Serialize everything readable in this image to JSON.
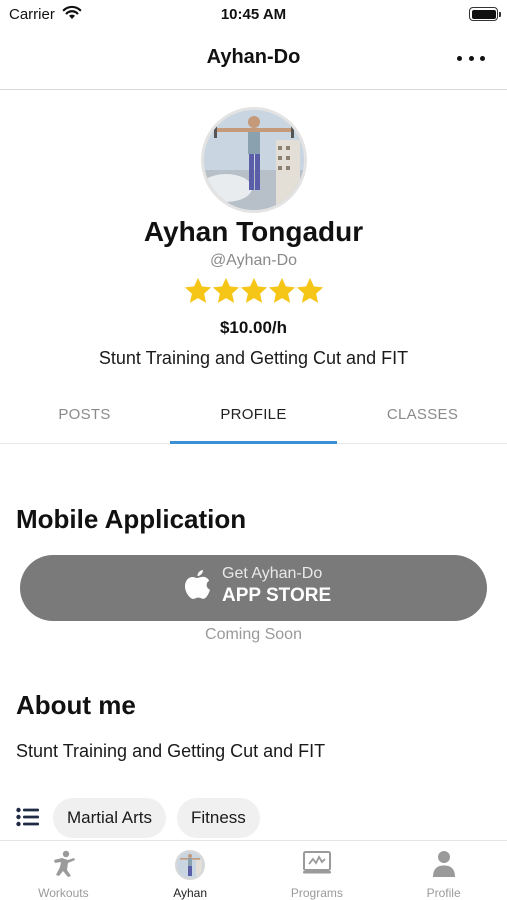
{
  "status_bar": {
    "carrier": "Carrier",
    "time": "10:45 AM"
  },
  "nav": {
    "title": "Ayhan-Do"
  },
  "profile": {
    "name": "Ayhan Tongadur",
    "handle": "@Ayhan-Do",
    "rating": 5,
    "max_rating": 5,
    "rate": "$10.00/h",
    "tagline": "Stunt Training and Getting Cut and FIT"
  },
  "tabs": [
    {
      "label": "POSTS",
      "active": false
    },
    {
      "label": "PROFILE",
      "active": true
    },
    {
      "label": "CLASSES",
      "active": false
    }
  ],
  "mobile_app": {
    "title": "Mobile Application",
    "button_small": "Get Ayhan-Do",
    "button_big": "APP STORE",
    "note": "Coming Soon"
  },
  "about": {
    "title": "About me",
    "text": "Stunt Training and Getting Cut and FIT",
    "tags": [
      "Martial Arts",
      "Fitness"
    ]
  },
  "tab_bar": [
    {
      "label": "Workouts",
      "icon": "workouts-icon",
      "active": false
    },
    {
      "label": "Ayhan",
      "icon": "avatar",
      "active": true
    },
    {
      "label": "Programs",
      "icon": "programs-icon",
      "active": false
    },
    {
      "label": "Profile",
      "icon": "profile-icon",
      "active": false
    }
  ],
  "colors": {
    "star": "#f5c518",
    "tab_indicator": "#3b8fd6",
    "store_button": "#7a7a7a"
  }
}
